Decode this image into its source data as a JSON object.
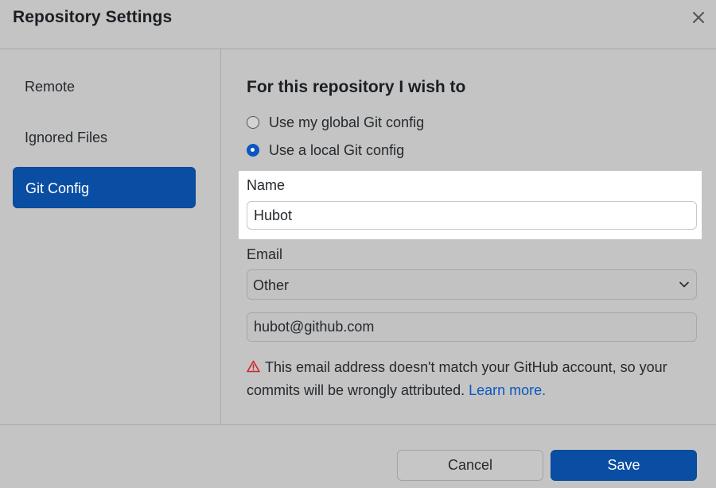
{
  "dialog": {
    "title": "Repository Settings",
    "close_icon": "close-icon"
  },
  "sidebar": {
    "items": [
      {
        "label": "Remote",
        "active": false
      },
      {
        "label": "Ignored Files",
        "active": false
      },
      {
        "label": "Git Config",
        "active": true
      }
    ]
  },
  "git_config": {
    "heading": "For this repository I wish to",
    "options": [
      {
        "label": "Use my global Git config",
        "selected": false
      },
      {
        "label": "Use a local Git config",
        "selected": true
      }
    ],
    "name": {
      "label": "Name",
      "value": "Hubot"
    },
    "email": {
      "label": "Email",
      "selected_option": "Other",
      "value": "hubot@github.com"
    },
    "warning": {
      "icon": "warning-icon",
      "text": "This email address doesn't match your GitHub account, so your commits will be wrongly attributed.",
      "link": "Learn more."
    }
  },
  "footer": {
    "cancel_label": "Cancel",
    "save_label": "Save"
  },
  "colors": {
    "accent": "#0a4ea3",
    "link": "#0a57c2",
    "warning": "#d1242f",
    "overlay": "#c4c4c4"
  }
}
